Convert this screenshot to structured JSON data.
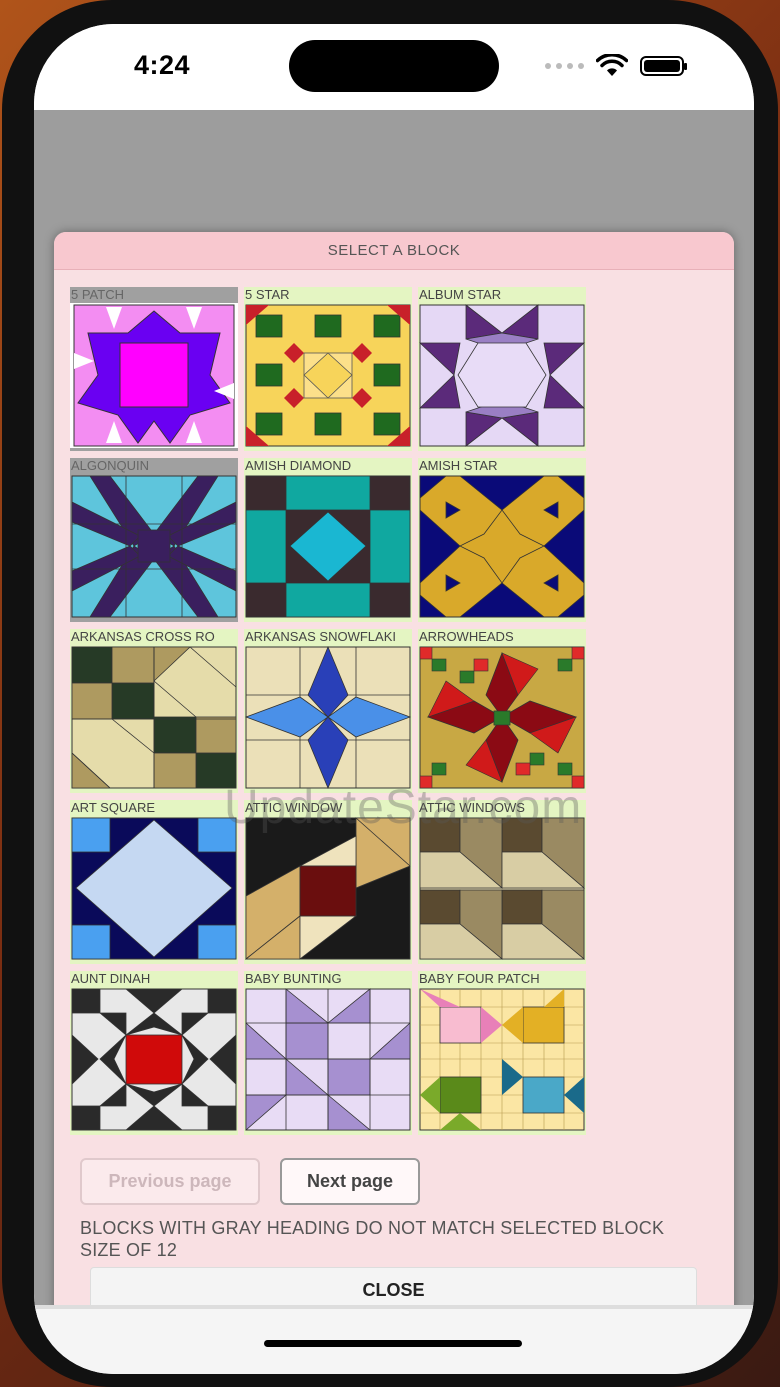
{
  "status_bar": {
    "time": "4:24"
  },
  "dialog": {
    "title": "SELECT A BLOCK",
    "blocks": [
      {
        "label": "5 PATCH",
        "gray": true
      },
      {
        "label": "5 STAR",
        "gray": false
      },
      {
        "label": "ALBUM STAR",
        "gray": false
      },
      {
        "label": "ALGONQUIN",
        "gray": true
      },
      {
        "label": "AMISH DIAMOND",
        "gray": false
      },
      {
        "label": "AMISH STAR",
        "gray": false
      },
      {
        "label": "ARKANSAS CROSS RO",
        "gray": false
      },
      {
        "label": "ARKANSAS SNOWFLAKI",
        "gray": false
      },
      {
        "label": "ARROWHEADS",
        "gray": false
      },
      {
        "label": "ART SQUARE",
        "gray": false
      },
      {
        "label": "ATTIC WINDOW",
        "gray": false
      },
      {
        "label": "ATTIC WINDOWS",
        "gray": false
      },
      {
        "label": "AUNT DINAH",
        "gray": false
      },
      {
        "label": "BABY BUNTING",
        "gray": false
      },
      {
        "label": "BABY FOUR PATCH",
        "gray": false
      }
    ],
    "previous_label": "Previous page",
    "next_label": "Next page",
    "notice": "BLOCKS WITH GRAY HEADING DO NOT MATCH SELECTED BLOCK SIZE OF 12",
    "close_label": "CLOSE"
  },
  "watermark": "UpdateStar.com",
  "colors": {
    "dialog_bg": "#f9e0e3",
    "title_bg": "#f8c8cf",
    "label_green": "#e4f5c2",
    "label_gray": "#a0a0a0"
  }
}
